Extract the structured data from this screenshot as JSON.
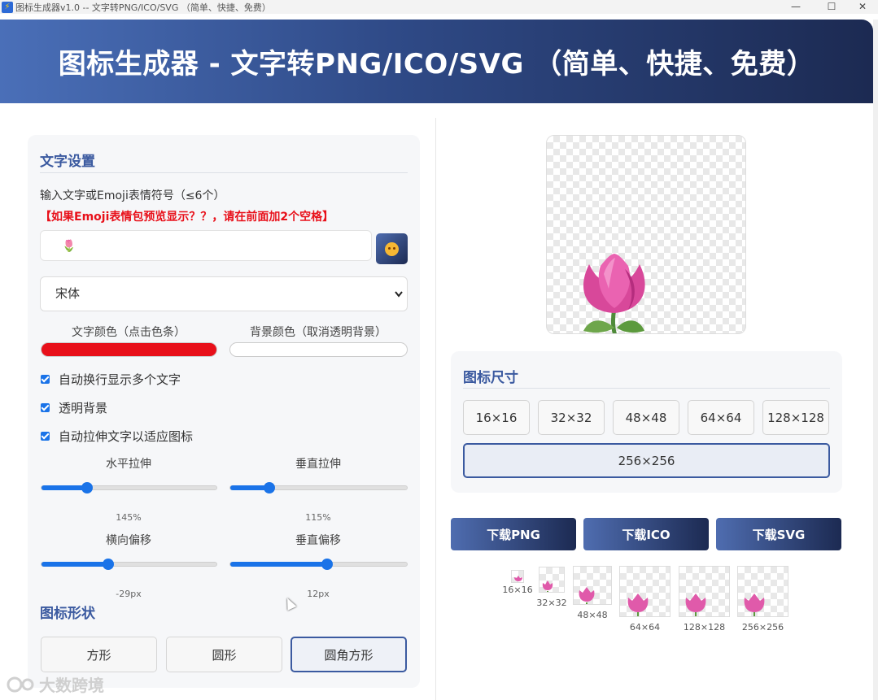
{
  "window": {
    "title": "图标生成器v1.0 -- 文字转PNG/ICO/SVG （简单、快捷、免费）",
    "minimize": "—",
    "maximize": "☐",
    "close": "✕"
  },
  "header": {
    "title": "图标生成器 - 文字转PNG/ICO/SVG （简单、快捷、免费）"
  },
  "text_settings": {
    "section_title": "文字设置",
    "input_label": "输入文字或Emoji表情符号（≤6个）",
    "warning": "【如果Emoji表情包预览显示？？，请在前面加2个空格】",
    "input_value": "🌷",
    "emoji_button_icon": "smiley-face",
    "font_selected": "宋体",
    "text_color_label": "文字颜色（点击色条）",
    "text_color": "#e8101a",
    "bg_color_label": "背景颜色（取消透明背景）",
    "bg_color": "#ffffff",
    "checkboxes": [
      {
        "label": "自动换行显示多个文字",
        "checked": true
      },
      {
        "label": "透明背景",
        "checked": true
      },
      {
        "label": "自动拉伸文字以适应图标",
        "checked": true
      }
    ],
    "sliders": {
      "h_stretch": {
        "label": "水平拉伸",
        "value": "145%",
        "fraction": 0.26
      },
      "v_stretch": {
        "label": "垂直拉伸",
        "value": "115%",
        "fraction": 0.22
      },
      "h_offset": {
        "label": "横向偏移",
        "value": "-29px",
        "fraction": 0.38
      },
      "v_offset": {
        "label": "垂直偏移",
        "value": "12px",
        "fraction": 0.55
      }
    }
  },
  "icon_shape": {
    "section_title": "图标形状",
    "options": [
      "方形",
      "圆形",
      "圆角方形"
    ],
    "selected": "圆角方形"
  },
  "icon_size": {
    "section_title": "图标尺寸",
    "options": [
      "16×16",
      "32×32",
      "48×48",
      "64×64",
      "128×128",
      "256×256"
    ],
    "selected": "256×256"
  },
  "downloads": [
    "下载PNG",
    "下载ICO",
    "下载SVG"
  ],
  "thumbnails": [
    "16×16",
    "32×32",
    "48×48",
    "64×64",
    "128×128",
    "256×256"
  ],
  "watermark": "大数跨境",
  "preview_icon": "tulip-emoji"
}
